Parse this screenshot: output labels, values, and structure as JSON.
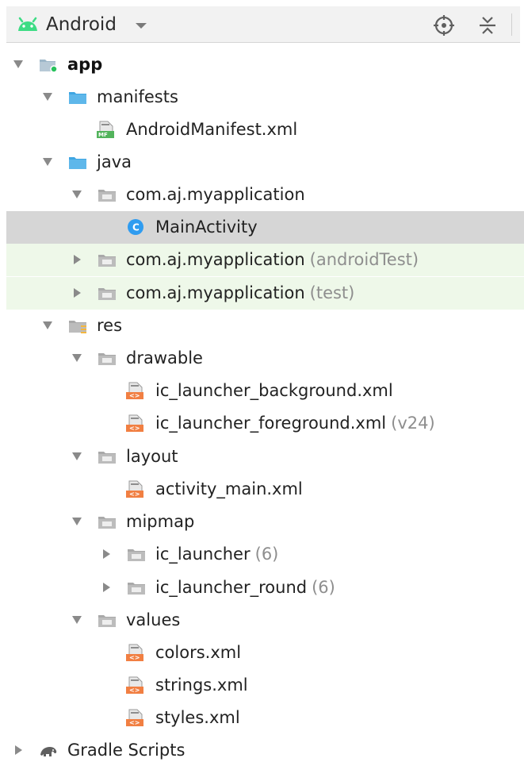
{
  "toolbar": {
    "title": "Android",
    "icons": {
      "logo": "android-logo-icon",
      "dropdown": "chevron-down-icon",
      "locate": "locate-target-icon",
      "collapse": "collapse-all-icon"
    },
    "colors": {
      "android_green": "#3ddc84",
      "toolbar_bg": "#f2f2f2",
      "folder_blue": "#3fa6e3",
      "package_gray": "#b8b8b8",
      "xml_orange": "#f17f42",
      "manifest_green": "#52b35b",
      "selected_bg": "#d6d6d6",
      "test_bg": "#eef8e9",
      "class_blue": "#2f9cf0"
    }
  },
  "tree": {
    "rows": [
      {
        "label": "app",
        "suffix": "",
        "level": 0,
        "toggle": "expanded",
        "icon": "module-folder-icon"
      },
      {
        "label": "manifests",
        "suffix": "",
        "level": 1,
        "toggle": "expanded",
        "icon": "folder-icon"
      },
      {
        "label": "AndroidManifest.xml",
        "suffix": "",
        "level": 2,
        "toggle": "none",
        "icon": "manifest-file-icon"
      },
      {
        "label": "java",
        "suffix": "",
        "level": 1,
        "toggle": "expanded",
        "icon": "folder-icon"
      },
      {
        "label": "com.aj.myapplication",
        "suffix": "",
        "level": 2,
        "toggle": "expanded",
        "icon": "package-folder-icon"
      },
      {
        "label": "MainActivity",
        "suffix": "",
        "level": 3,
        "toggle": "none",
        "icon": "java-class-icon",
        "selected": true
      },
      {
        "label": "com.aj.myapplication",
        "suffix": "(androidTest)",
        "level": 2,
        "toggle": "collapsed",
        "icon": "package-folder-icon",
        "test": true
      },
      {
        "label": "com.aj.myapplication",
        "suffix": "(test)",
        "level": 2,
        "toggle": "collapsed",
        "icon": "package-folder-icon",
        "test": true
      },
      {
        "label": "res",
        "suffix": "",
        "level": 1,
        "toggle": "expanded",
        "icon": "resources-folder-icon"
      },
      {
        "label": "drawable",
        "suffix": "",
        "level": 2,
        "toggle": "expanded",
        "icon": "package-folder-icon"
      },
      {
        "label": "ic_launcher_background.xml",
        "suffix": "",
        "level": 3,
        "toggle": "none",
        "icon": "xml-file-icon"
      },
      {
        "label": "ic_launcher_foreground.xml",
        "suffix": "(v24)",
        "level": 3,
        "toggle": "none",
        "icon": "xml-file-icon"
      },
      {
        "label": "layout",
        "suffix": "",
        "level": 2,
        "toggle": "expanded",
        "icon": "package-folder-icon"
      },
      {
        "label": "activity_main.xml",
        "suffix": "",
        "level": 3,
        "toggle": "none",
        "icon": "xml-file-icon"
      },
      {
        "label": "mipmap",
        "suffix": "",
        "level": 2,
        "toggle": "expanded",
        "icon": "package-folder-icon"
      },
      {
        "label": "ic_launcher",
        "suffix": "(6)",
        "level": 3,
        "toggle": "collapsed",
        "icon": "package-folder-icon"
      },
      {
        "label": "ic_launcher_round",
        "suffix": "(6)",
        "level": 3,
        "toggle": "collapsed",
        "icon": "package-folder-icon"
      },
      {
        "label": "values",
        "suffix": "",
        "level": 2,
        "toggle": "expanded",
        "icon": "package-folder-icon"
      },
      {
        "label": "colors.xml",
        "suffix": "",
        "level": 3,
        "toggle": "none",
        "icon": "xml-file-icon"
      },
      {
        "label": "strings.xml",
        "suffix": "",
        "level": 3,
        "toggle": "none",
        "icon": "xml-file-icon"
      },
      {
        "label": "styles.xml",
        "suffix": "",
        "level": 3,
        "toggle": "none",
        "icon": "xml-file-icon"
      },
      {
        "label": "Gradle Scripts",
        "suffix": "",
        "level": 0,
        "toggle": "collapsed",
        "icon": "gradle-icon"
      }
    ]
  }
}
